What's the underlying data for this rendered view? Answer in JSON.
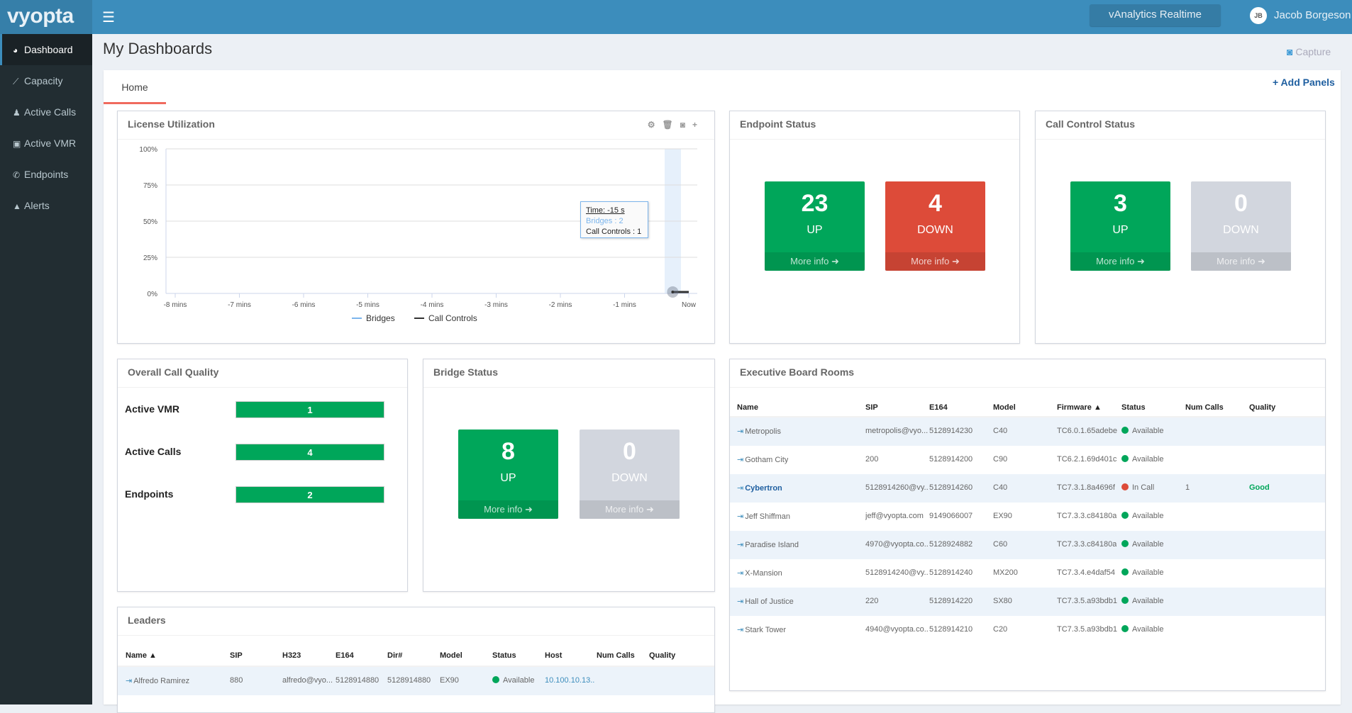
{
  "app": {
    "logo": "vyopta",
    "realtime_button": "vAnalytics Realtime",
    "user_initials": "JB",
    "user_name": "Jacob Borgeson"
  },
  "sidebar": {
    "items": [
      {
        "label": "Dashboard",
        "icon": "dashboard-icon",
        "active": true
      },
      {
        "label": "Capacity",
        "icon": "area-chart-icon"
      },
      {
        "label": "Active Calls",
        "icon": "users-icon"
      },
      {
        "label": "Active VMR",
        "icon": "desktop-icon"
      },
      {
        "label": "Endpoints",
        "icon": "phone-icon"
      },
      {
        "label": "Alerts",
        "icon": "warning-icon"
      }
    ]
  },
  "page": {
    "title": "My Dashboards",
    "capture": "Capture",
    "tab": "Home",
    "add_panels": "+ Add Panels"
  },
  "license": {
    "title": "License Utilization",
    "tooltip": {
      "time": "Time: -15 s",
      "bridges": "Bridges : 2",
      "call_controls": "Call Controls : 1"
    }
  },
  "chart_data": {
    "type": "line",
    "title": "License Utilization",
    "x_ticks": [
      "-8 mins",
      "-7 mins",
      "-6 mins",
      "-5 mins",
      "-4 mins",
      "-3 mins",
      "-2 mins",
      "-1 mins",
      "Now"
    ],
    "y_ticks": [
      "100%",
      "75%",
      "50%",
      "25%",
      "0%"
    ],
    "ylim": [
      0,
      100
    ],
    "grid": true,
    "legend": "bottom",
    "series": [
      {
        "name": "Bridges",
        "color": "#7cb5ec",
        "x": [
          -0.25,
          0
        ],
        "y": [
          1,
          1
        ]
      },
      {
        "name": "Call Controls",
        "color": "#333333",
        "x": [
          -0.25,
          0
        ],
        "y": [
          1,
          1
        ]
      }
    ]
  },
  "endpoint_status": {
    "title": "Endpoint Status",
    "up": {
      "value": "23",
      "label": "UP",
      "more": "More info"
    },
    "down": {
      "value": "4",
      "label": "DOWN",
      "more": "More info"
    }
  },
  "call_control_status": {
    "title": "Call Control Status",
    "up": {
      "value": "3",
      "label": "UP",
      "more": "More info"
    },
    "down": {
      "value": "0",
      "label": "DOWN",
      "more": "More info"
    }
  },
  "bridge_status": {
    "title": "Bridge Status",
    "up": {
      "value": "8",
      "label": "UP",
      "more": "More info"
    },
    "down": {
      "value": "0",
      "label": "DOWN",
      "more": "More info"
    }
  },
  "colors": {
    "up": "#00a65a",
    "down": "#dd4b39",
    "zero": "#d2d6de",
    "header": "#3c8dbc"
  },
  "call_quality": {
    "title": "Overall Call Quality",
    "rows": [
      {
        "label": "Active VMR",
        "value": "1"
      },
      {
        "label": "Active Calls",
        "value": "4"
      },
      {
        "label": "Endpoints",
        "value": "2"
      }
    ]
  },
  "boardrooms": {
    "title": "Executive Board Rooms",
    "columns": [
      "Name",
      "SIP",
      "E164",
      "Model",
      "Firmware ▲",
      "Status",
      "Num Calls",
      "Quality"
    ],
    "rows": [
      [
        "Metropolis",
        "metropolis@vyo...",
        "5128914230",
        "C40",
        "TC6.0.1.65adebe",
        "Available",
        "",
        ""
      ],
      [
        "Gotham City",
        "200",
        "5128914200",
        "C90",
        "TC6.2.1.69d401c",
        "Available",
        "",
        ""
      ],
      [
        "Cybertron",
        "5128914260@vy...",
        "5128914260",
        "C40",
        "TC7.3.1.8a4696f",
        "In Call",
        "1",
        "Good"
      ],
      [
        "Jeff Shiffman",
        "jeff@vyopta.com",
        "9149066007",
        "EX90",
        "TC7.3.3.c84180a",
        "Available",
        "",
        ""
      ],
      [
        "Paradise Island",
        "4970@vyopta.co...",
        "5128924882",
        "C60",
        "TC7.3.3.c84180a",
        "Available",
        "",
        ""
      ],
      [
        "X-Mansion",
        "5128914240@vy...",
        "5128914240",
        "MX200",
        "TC7.3.4.e4daf54",
        "Available",
        "",
        ""
      ],
      [
        "Hall of Justice",
        "220",
        "5128914220",
        "SX80",
        "TC7.3.5.a93bdb1",
        "Available",
        "",
        ""
      ],
      [
        "Stark Tower",
        "4940@vyopta.co...",
        "5128914210",
        "C20",
        "TC7.3.5.a93bdb1",
        "Available",
        "",
        ""
      ]
    ]
  },
  "leaders": {
    "title": "Leaders",
    "columns": [
      "Name ▲",
      "SIP",
      "H323",
      "E164",
      "Dir#",
      "Model",
      "Status",
      "Host",
      "Num Calls",
      "Quality"
    ],
    "rows": [
      [
        "Alfredo Ramirez",
        "880",
        "alfredo@vyo...",
        "5128914880",
        "5128914880",
        "EX90",
        "Available",
        "10.100.10.13...",
        "",
        ""
      ]
    ]
  }
}
